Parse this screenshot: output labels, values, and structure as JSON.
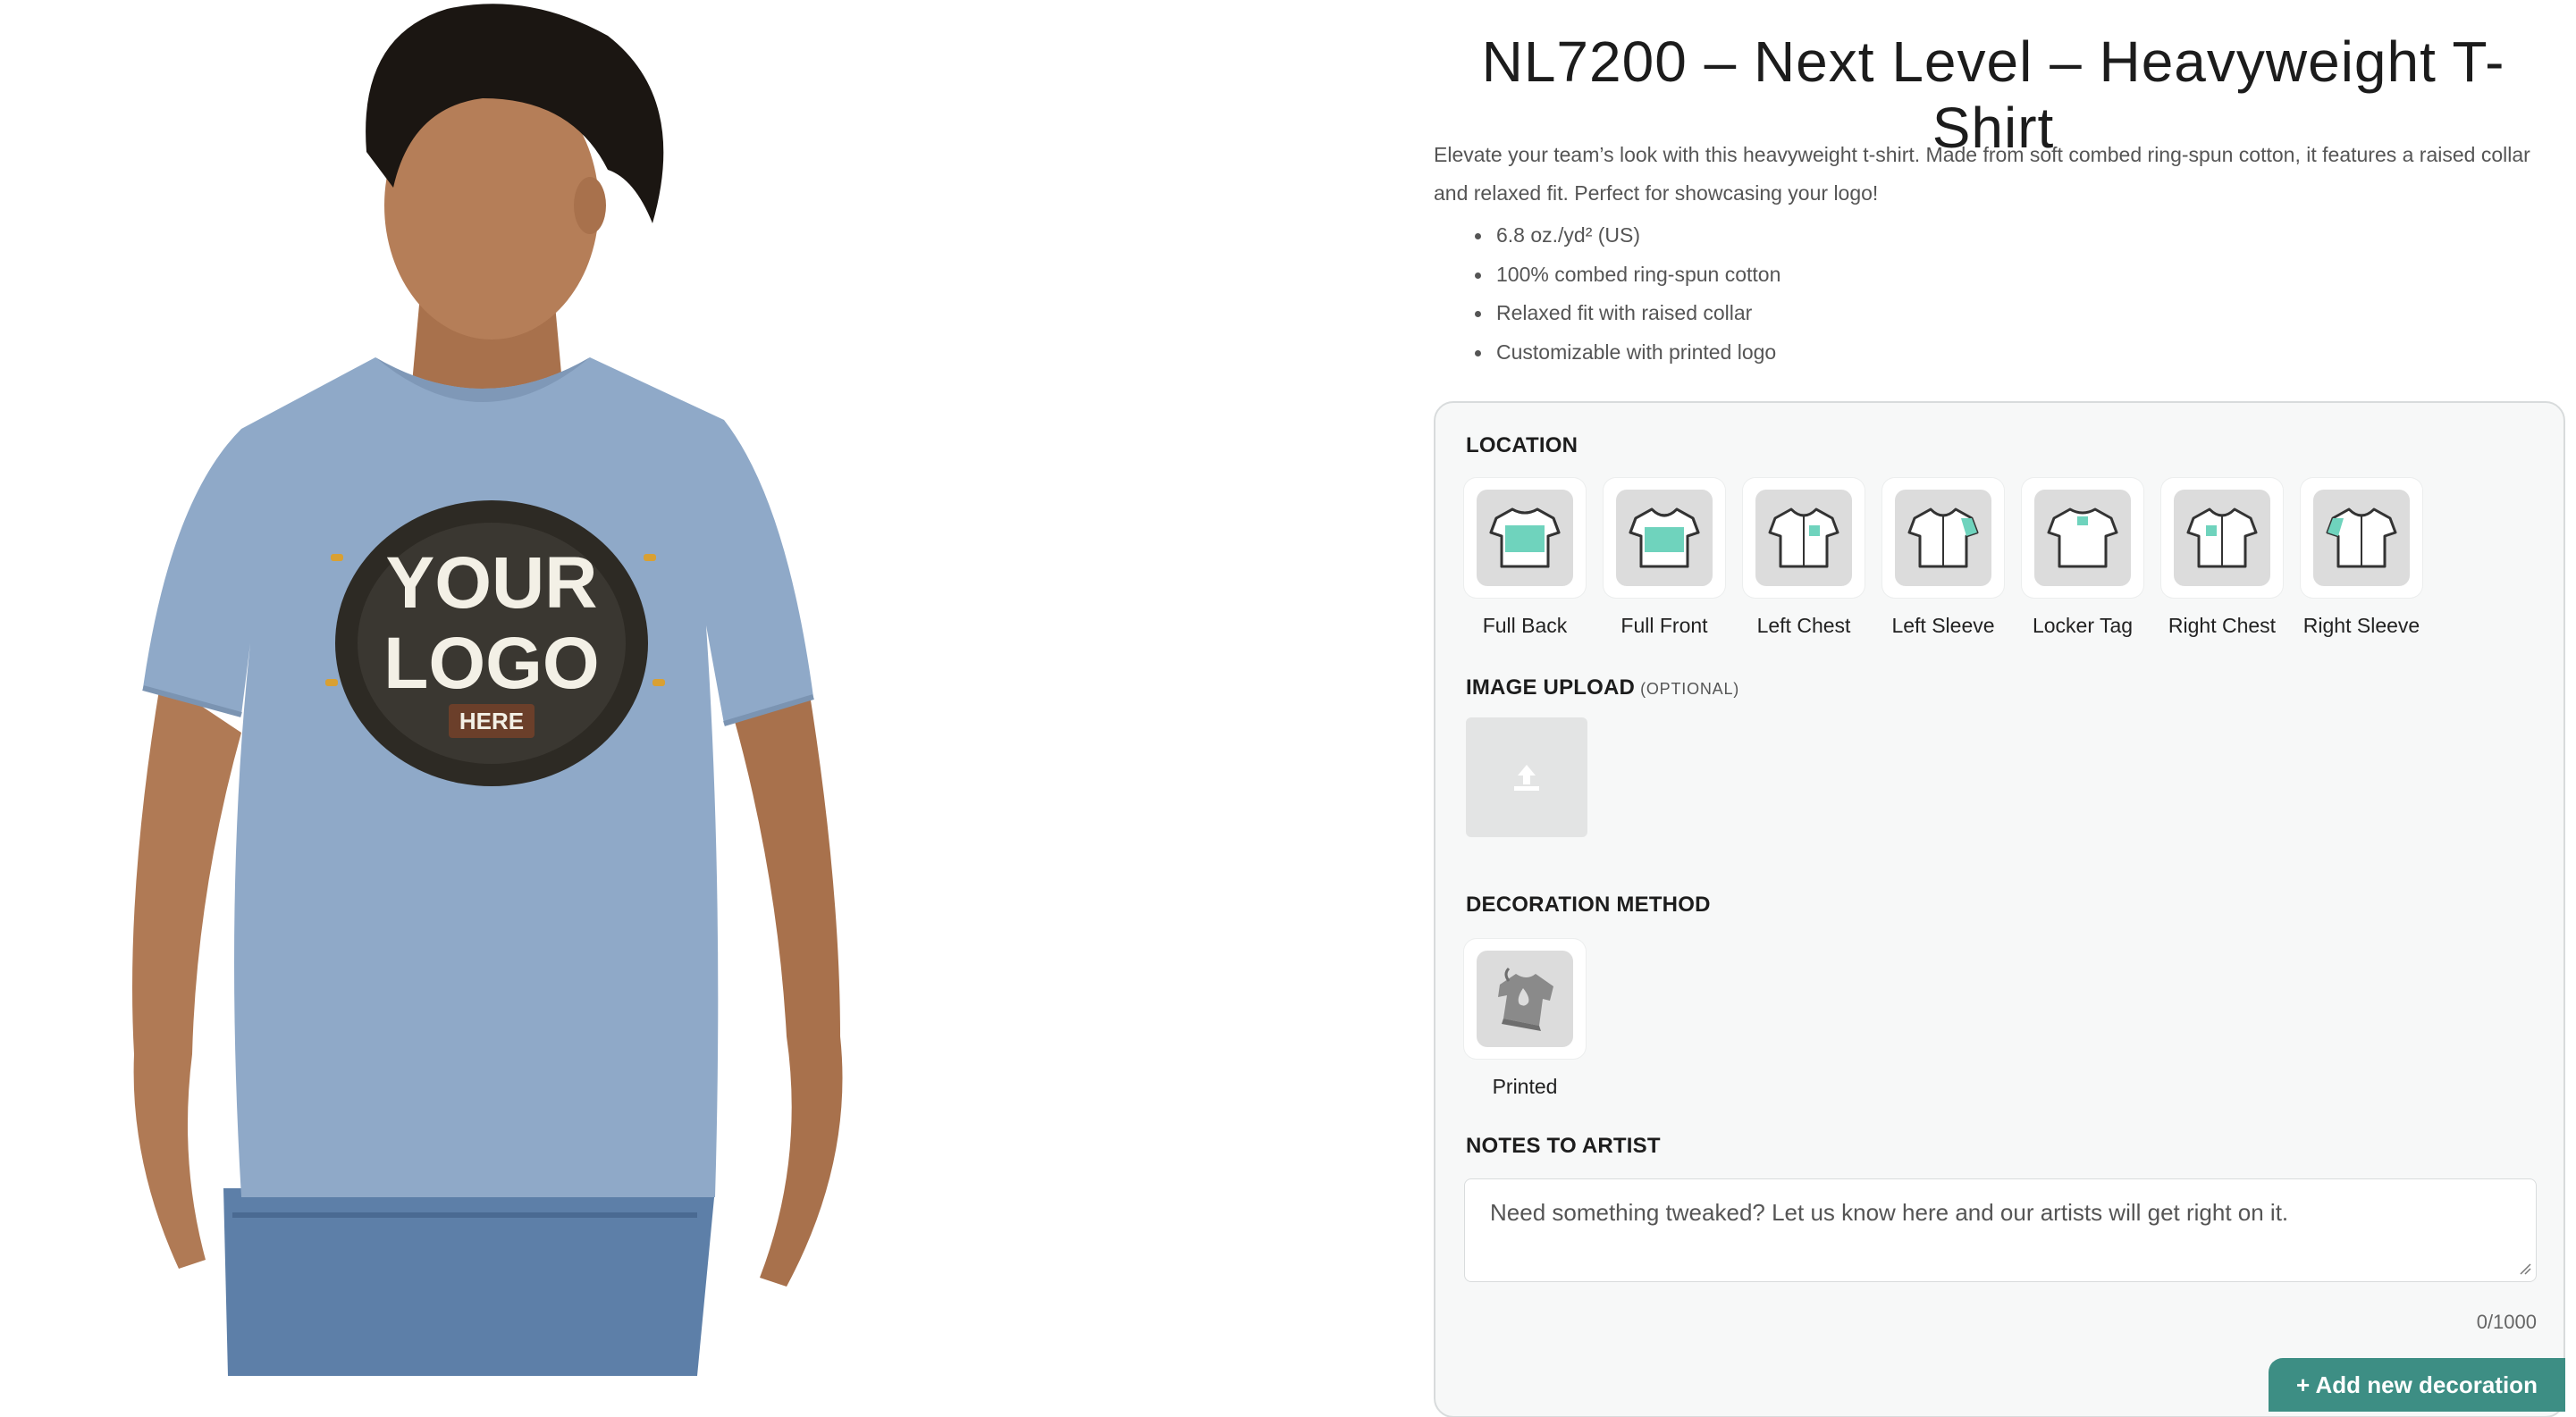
{
  "product": {
    "title": "NL7200 – Next Level – Heavyweight T-Shirt",
    "description": "Elevate your team’s look with this heavyweight t-shirt. Made from soft combed ring-spun cotton, it features a raised collar and relaxed fit. Perfect for showcasing your logo!",
    "features": [
      "6.8 oz./yd² (US)",
      "100% combed ring-spun cotton",
      "Relaxed fit with raised collar",
      "Customizable with printed logo"
    ],
    "image_logo_text": [
      "YOUR",
      "LOGO",
      "HERE"
    ]
  },
  "customizer": {
    "location_label": "LOCATION",
    "locations": [
      {
        "label": "Full Back",
        "icon": "shirt-full-back-icon"
      },
      {
        "label": "Full Front",
        "icon": "shirt-full-front-icon"
      },
      {
        "label": "Left Chest",
        "icon": "shirt-left-chest-icon"
      },
      {
        "label": "Left Sleeve",
        "icon": "shirt-left-sleeve-icon"
      },
      {
        "label": "Locker Tag",
        "icon": "shirt-locker-tag-icon"
      },
      {
        "label": "Right Chest",
        "icon": "shirt-right-chest-icon"
      },
      {
        "label": "Right Sleeve",
        "icon": "shirt-right-sleeve-icon"
      }
    ],
    "image_upload_label": "IMAGE UPLOAD",
    "image_upload_optional": "(OPTIONAL)",
    "decoration_label": "DECORATION METHOD",
    "decoration_methods": [
      {
        "label": "Printed",
        "icon": "printed-shirt-icon"
      }
    ],
    "notes_label": "NOTES TO ARTIST",
    "notes_placeholder": "Need something tweaked? Let us know here and our artists will get right on it.",
    "notes_value": "",
    "notes_counter": "0/1000",
    "add_button_label": "+ Add new decoration"
  },
  "colors": {
    "accent": "#3d8e84",
    "highlight": "#6fd3bd",
    "shirt": "#8fa9c8",
    "panel_bg": "#f7f8f8"
  }
}
